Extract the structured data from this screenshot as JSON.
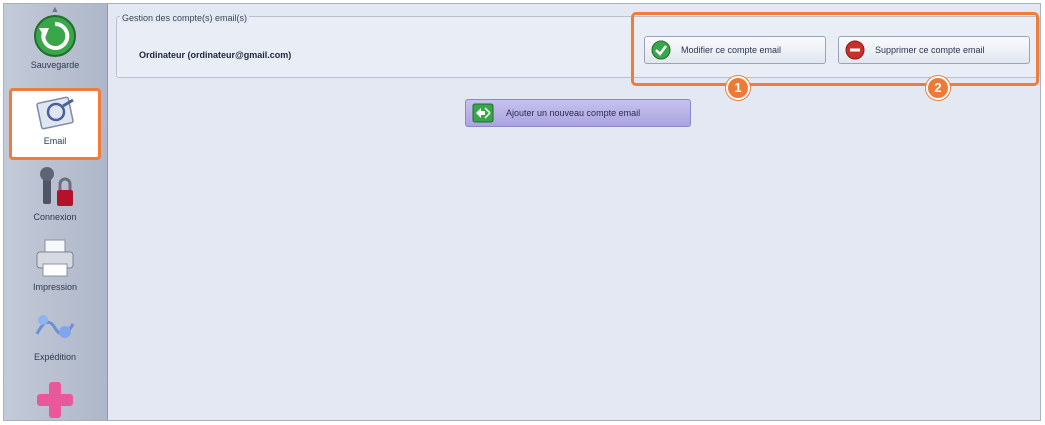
{
  "sidebar": {
    "items": [
      {
        "label": "Sauvegarde",
        "icon": "refresh-icon"
      },
      {
        "label": "Email",
        "icon": "email-settings-icon"
      },
      {
        "label": "Connexion",
        "icon": "wrench-lock-icon"
      },
      {
        "label": "Impression",
        "icon": "printer-icon"
      },
      {
        "label": "Expédition",
        "icon": "shipping-icon"
      },
      {
        "label": "",
        "icon": "plus-icon"
      }
    ],
    "active_index": 1
  },
  "account_group": {
    "title": "Gestion des compte(s) email(s)",
    "account_label": "Ordinateur (ordinateur@gmail.com)",
    "edit_button": "Modifier ce compte email",
    "delete_button": "Supprimer ce compte email"
  },
  "add_button": "Ajouter un nouveau compte email",
  "badges": [
    "1",
    "2"
  ],
  "colors": {
    "highlight": "#f07c3a",
    "sidebar": "#aeb7c9",
    "content_bg": "#e3e8f2",
    "add_button": "#aaa3e0",
    "ok_green": "#3aa64a",
    "delete_red": "#c9302c"
  }
}
